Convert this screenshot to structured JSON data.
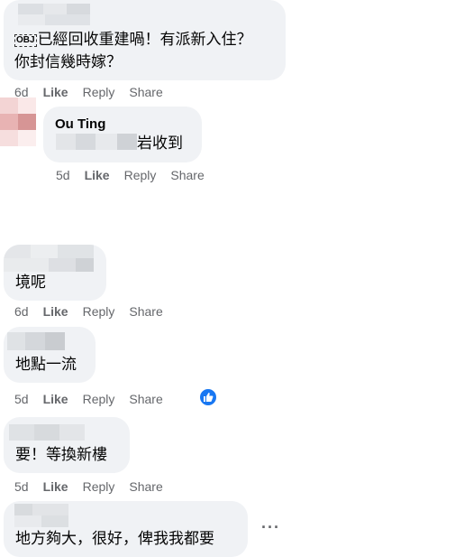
{
  "comments": [
    {
      "text_line1": "已經回收重建喎！有派新入住？",
      "text_line2": "你封信幾時嫁？",
      "emoji_badge": "OBJ",
      "time": "6d",
      "like": "Like",
      "reply": "Reply",
      "share": "Share"
    },
    {
      "author": "Ou Ting",
      "text": "岩收到",
      "time": "5d",
      "like": "Like",
      "reply": "Reply",
      "share": "Share"
    },
    {
      "text": "境呢",
      "time": "6d",
      "like": "Like",
      "reply": "Reply",
      "share": "Share"
    },
    {
      "text": "地點一流",
      "time": "5d",
      "like": "Like",
      "reply": "Reply",
      "share": "Share",
      "reaction_icon": "thumbs-up-icon"
    },
    {
      "text": "要！等換新樓",
      "time": "5d",
      "like": "Like",
      "reply": "Reply",
      "share": "Share"
    },
    {
      "text": "地方夠大，很好，俾我我都要",
      "more_icon": "more-options-icon"
    }
  ],
  "colors": {
    "bubble": "#f0f2f5",
    "meta_text": "#65676b",
    "reaction_blue": "#1877f2"
  }
}
